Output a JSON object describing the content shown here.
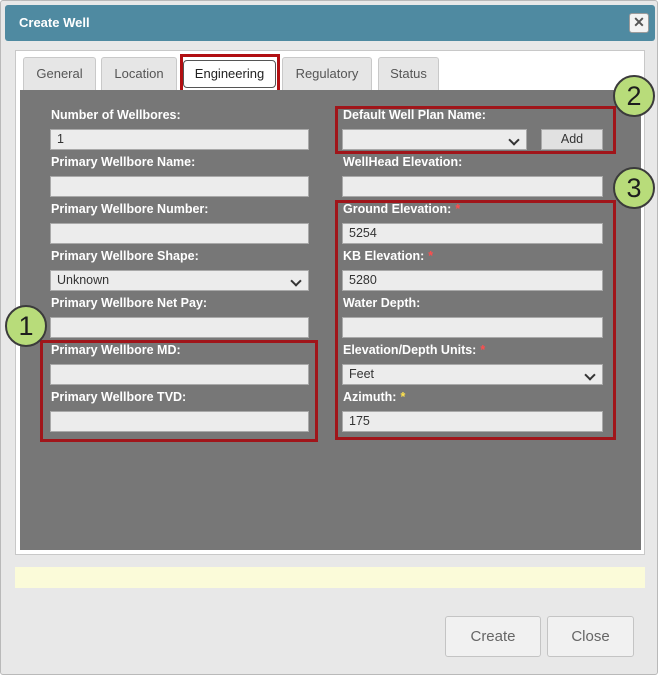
{
  "window": {
    "title": "Create Well",
    "close_symbol": "✕"
  },
  "tabs": [
    {
      "label": "General"
    },
    {
      "label": "Location"
    },
    {
      "label": "Engineering"
    },
    {
      "label": "Regulatory"
    },
    {
      "label": "Status"
    }
  ],
  "active_tab": "Engineering",
  "left_fields": {
    "num_wellbores": {
      "label": "Number of Wellbores:",
      "value": "1"
    },
    "primary_name": {
      "label": "Primary Wellbore Name:",
      "value": ""
    },
    "primary_number": {
      "label": "Primary Wellbore Number:",
      "value": ""
    },
    "primary_shape": {
      "label": "Primary Wellbore Shape:",
      "value": "Unknown"
    },
    "primary_net_pay": {
      "label": "Primary Wellbore Net Pay:",
      "value": ""
    },
    "primary_md": {
      "label": "Primary Wellbore MD:",
      "value": ""
    },
    "primary_tvd": {
      "label": "Primary Wellbore TVD:",
      "value": ""
    }
  },
  "right_fields": {
    "default_plan": {
      "label": "Default Well Plan Name:",
      "value": "",
      "add_label": "Add"
    },
    "wellhead_elev": {
      "label": "WellHead Elevation:",
      "value": ""
    },
    "ground_elev": {
      "label": "Ground Elevation:",
      "value": "5254",
      "required": "*"
    },
    "kb_elev": {
      "label": "KB Elevation:",
      "value": "5280",
      "required": "*"
    },
    "water_depth": {
      "label": "Water Depth:",
      "value": ""
    },
    "units": {
      "label": "Elevation/Depth Units:",
      "value": "Feet",
      "required": "*"
    },
    "azimuth": {
      "label": "Azimuth:",
      "value": "175",
      "required": "*"
    }
  },
  "callouts": {
    "one": "1",
    "two": "2",
    "three": "3"
  },
  "footer": {
    "create_label": "Create",
    "close_label": "Close"
  },
  "colors": {
    "titlebar": "#4f8aa1",
    "panel": "#777777",
    "highlight_box": "#a0151a",
    "callout_fill": "#b8dc7a",
    "required_red": "#ff4d4d",
    "required_yellow": "#ffe34d"
  }
}
